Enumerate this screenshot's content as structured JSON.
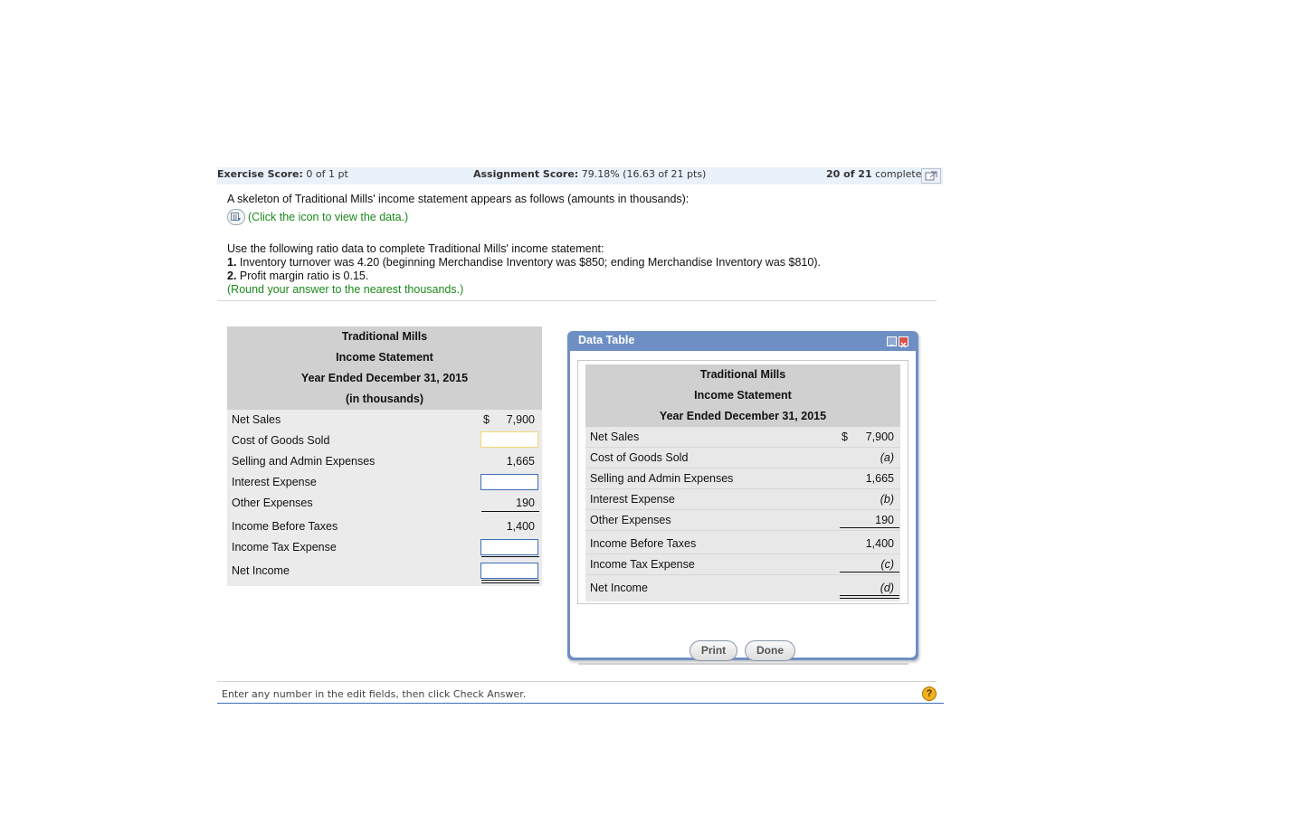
{
  "score_bar": {
    "exercise_label": "Exercise Score:",
    "exercise_value": "0 of 1 pt",
    "assignment_label": "Assignment Score:",
    "assignment_value": "79.18% (16.63 of 21 pts)",
    "complete_count": "20 of 21",
    "complete_word": "complete"
  },
  "question": {
    "intro": "A skeleton of Traditional Mills' income statement appears as follows (amounts in thousands):",
    "data_link": "(Click the icon to view the data.)",
    "instructions": "Use the following ratio data to complete Traditional Mills' income statement:",
    "item1_num": "1.",
    "item1_text": "Inventory turnover was 4.20 (beginning Merchandise Inventory was $850; ending Merchandise Inventory was $810).",
    "item2_num": "2.",
    "item2_text": "Profit margin ratio is 0.15.",
    "round_note": "(Round your answer to the nearest thousands.)"
  },
  "statement": {
    "company": "Traditional Mills",
    "title": "Income Statement",
    "period": "Year Ended December 31, 2015",
    "units": "(in thousands)",
    "currency": "$",
    "rows": [
      {
        "label": "Net Sales",
        "value": "7,900"
      },
      {
        "label": "Cost of Goods Sold",
        "value": ""
      },
      {
        "label": "Selling and Admin Expenses",
        "value": "1,665"
      },
      {
        "label": "Interest Expense",
        "value": ""
      },
      {
        "label": "Other Expenses",
        "value": "190"
      },
      {
        "label": "Income Before Taxes",
        "value": "1,400"
      },
      {
        "label": "Income Tax Expense",
        "value": ""
      },
      {
        "label": "Net Income",
        "value": ""
      }
    ]
  },
  "modal": {
    "title": "Data Table",
    "company": "Traditional Mills",
    "statement_title": "Income Statement",
    "period": "Year Ended December 31, 2015",
    "currency": "$",
    "rows": [
      {
        "label": "Net Sales",
        "value": "7,900"
      },
      {
        "label": "Cost of Goods Sold",
        "value": "(a)"
      },
      {
        "label": "Selling and Admin Expenses",
        "value": "1,665"
      },
      {
        "label": "Interest Expense",
        "value": "(b)"
      },
      {
        "label": "Other Expenses",
        "value": "190"
      },
      {
        "label": "Income Before Taxes",
        "value": "1,400"
      },
      {
        "label": "Income Tax Expense",
        "value": "(c)"
      },
      {
        "label": "Net Income",
        "value": "(d)"
      }
    ],
    "print_label": "Print",
    "done_label": "Done"
  },
  "footer": {
    "hint": "Enter any number in the edit fields, then click Check Answer.",
    "help_symbol": "?"
  },
  "colors": {
    "modal_frame": "#6e8fc3",
    "input_border": "#3d6fb8",
    "active_input_border": "#f0d77a",
    "link_green": "#1b8a1b",
    "help_orange": "#f2b01e"
  }
}
